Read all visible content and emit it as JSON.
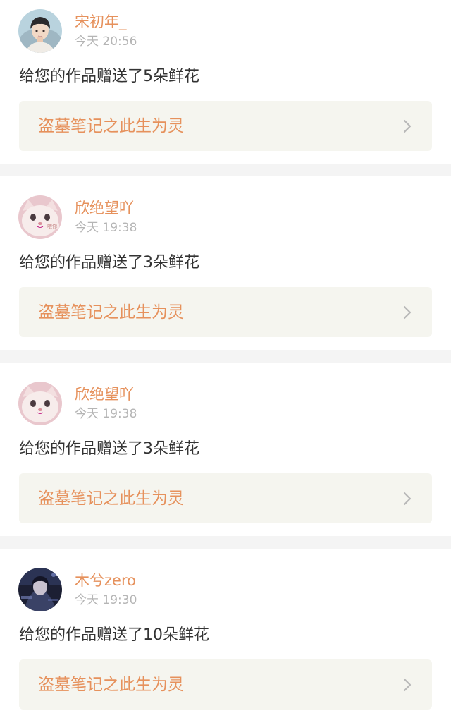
{
  "notifications": [
    {
      "username": "宋初年_",
      "time": "今天 20:56",
      "message": "给您的作品赠送了5朵鲜花",
      "work_title": "盗墓笔记之此生为灵",
      "avatar_icon": "boy-portrait-icon"
    },
    {
      "username": "欣绝望吖",
      "time": "今天 19:38",
      "message": "给您的作品赠送了3朵鲜花",
      "work_title": "盗墓笔记之此生为灵",
      "avatar_icon": "cat-face-icon",
      "avatar_text": "喂你"
    },
    {
      "username": "欣绝望吖",
      "time": "今天 19:38",
      "message": "给您的作品赠送了3朵鲜花",
      "work_title": "盗墓笔记之此生为灵",
      "avatar_icon": "cat-face-icon"
    },
    {
      "username": "木兮zero",
      "time": "今天 19:30",
      "message": "给您的作品赠送了10朵鲜花",
      "work_title": "盗墓笔记之此生为灵",
      "avatar_icon": "dark-anime-portrait-icon"
    }
  ],
  "colors": {
    "accent": "#e6915c",
    "timestamp": "#b5b5b5",
    "message": "#333333",
    "card_background": "#f5f5ef",
    "page_background": "#f4f4f4"
  },
  "icons": {
    "chevron": "chevron-right-icon"
  }
}
